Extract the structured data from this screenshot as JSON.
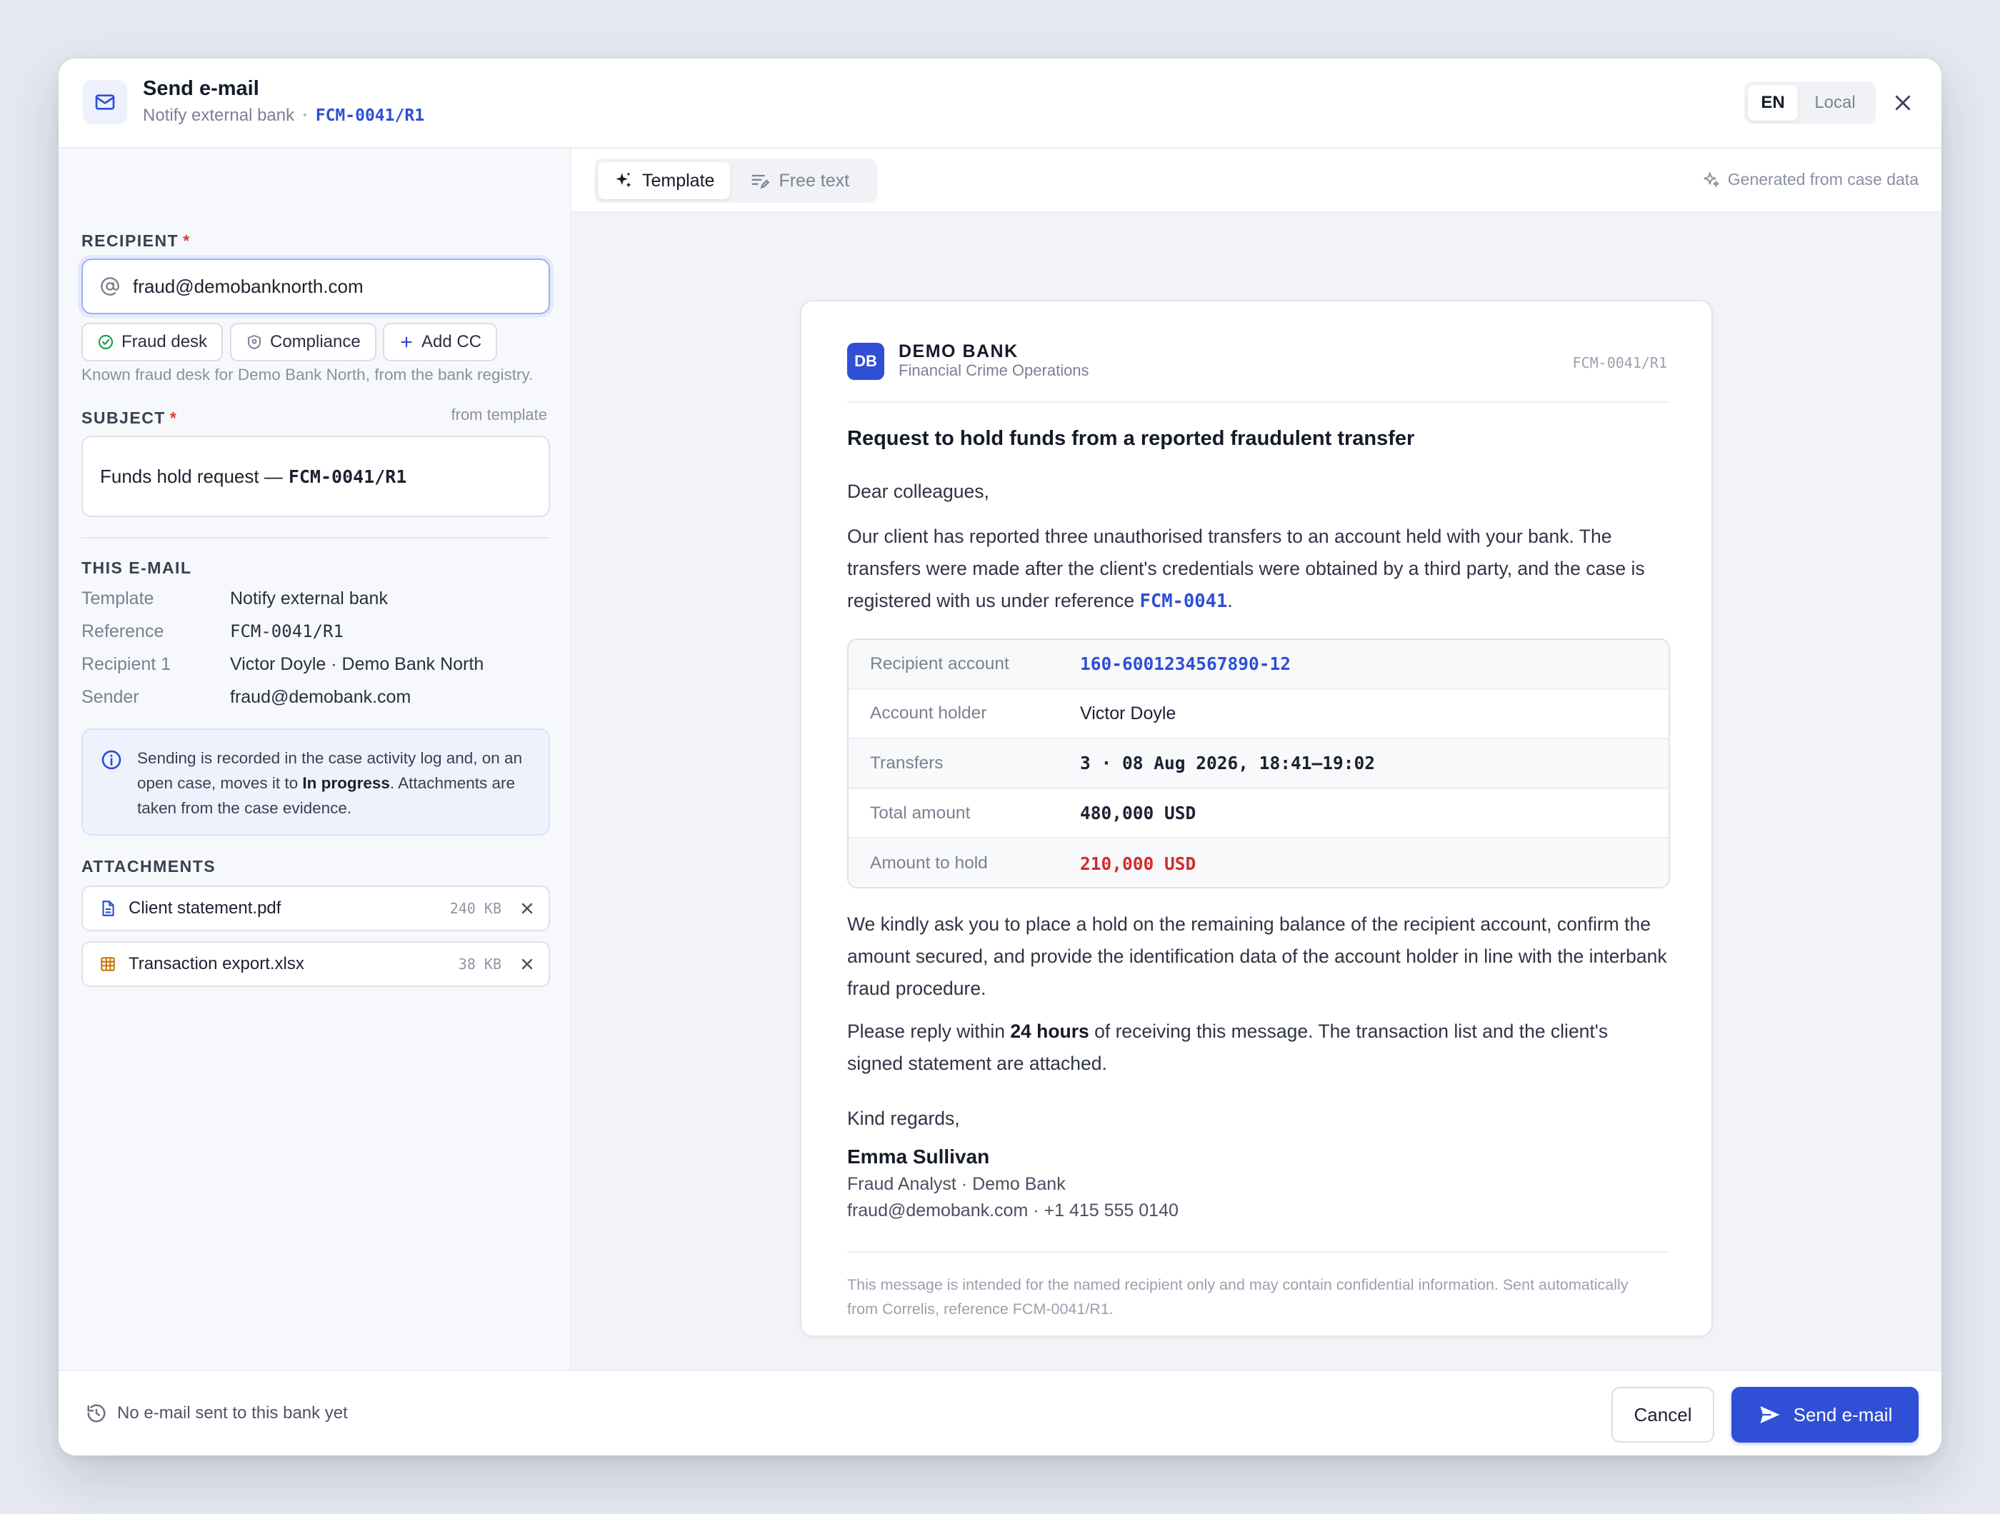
{
  "header": {
    "title": "Send e-mail",
    "subtitle": "Notify external bank",
    "separator": "•",
    "reference": "FCM-0041/R1",
    "lang_options": [
      "EN",
      "Local"
    ],
    "lang_selected": "EN"
  },
  "recipient": {
    "label": "RECIPIENT",
    "required_mark": "*",
    "value": "fraud@demobanknorth.com",
    "chips": [
      {
        "label": "Fraud desk",
        "icon": "check-circle-icon"
      },
      {
        "label": "Compliance",
        "icon": "shield-icon"
      },
      {
        "label": "Add CC",
        "icon": "plus-icon"
      }
    ],
    "hint": "Known fraud desk for Demo Bank North, from the bank registry."
  },
  "subject": {
    "label": "SUBJECT",
    "required_mark": "*",
    "source": "from template",
    "text": "Funds hold request —",
    "reference": "FCM-0041/R1"
  },
  "this_email": {
    "label": "THIS E-MAIL",
    "rows": [
      {
        "key": "Template",
        "value": "Notify external bank"
      },
      {
        "key": "Reference",
        "value": "FCM-0041/R1"
      },
      {
        "key": "Recipient 1",
        "value": "Victor Doyle · Demo Bank North"
      },
      {
        "key": "Sender",
        "value": "fraud@demobank.com"
      }
    ]
  },
  "info": {
    "text_before": "Sending is recorded in the case activity log and, on an open case, moves it to ",
    "bold": "In progress",
    "text_after": ". Attachments are taken from the case evidence."
  },
  "attachments": {
    "label": "ATTACHMENTS",
    "items": [
      {
        "name": "Client statement.pdf",
        "size": "240 KB",
        "icon": "document-icon"
      },
      {
        "name": "Transaction export.xlsx",
        "size": "38 KB",
        "icon": "spreadsheet-icon"
      }
    ]
  },
  "tabs": {
    "items": [
      "Template",
      "Free text"
    ],
    "active": "Template",
    "generated_note": "Generated from case data"
  },
  "letter": {
    "logo": "DB",
    "bank_name": "DEMO BANK",
    "department": "Financial Crime Operations",
    "reference": "FCM-0041/R1",
    "title": "Request to hold funds from a reported fraudulent transfer",
    "greeting": "Dear colleagues,",
    "p1_before": "Our client has reported three unauthorised transfers to an account held with your bank. The transfers were made after the client's credentials were obtained by a third party, and the case is registered with us under reference ",
    "p1_ref": "FCM-0041",
    "p1_after": ".",
    "table": [
      {
        "key": "Recipient account",
        "value": "160-6001234567890-12"
      },
      {
        "key": "Account holder",
        "value": "Victor Doyle"
      },
      {
        "key": "Transfers",
        "value": "3 · 08 Aug 2026, 18:41–19:02"
      },
      {
        "key": "Total amount",
        "value": "480,000 USD"
      },
      {
        "key": "Amount to hold",
        "value": "210,000 USD"
      }
    ],
    "p2": "We kindly ask you to place a hold on the remaining balance of the recipient account, confirm the amount secured, and provide the identification data of the account holder in line with the interbank fraud procedure.",
    "p3_before": "Please reply within ",
    "p3_bold": "24 hours",
    "p3_after": " of receiving this message. The transaction list and the client's signed statement are attached.",
    "closing": "Kind regards,",
    "signer_name": "Emma Sullivan",
    "signer_title": "Fraud Analyst · Demo Bank",
    "signer_contact": "fraud@demobank.com · +1 415 555 0140",
    "footnote": "This message is intended for the named recipient only and may contain confidential information. Sent automatically from Correlis, reference FCM-0041/R1."
  },
  "footer": {
    "note": "No e-mail sent to this bank yet",
    "cancel_label": "Cancel",
    "send_label": "Send e-mail"
  },
  "colors": {
    "accent": "#2f4fd6",
    "danger": "#d32b2b",
    "required": "#e0392f"
  }
}
